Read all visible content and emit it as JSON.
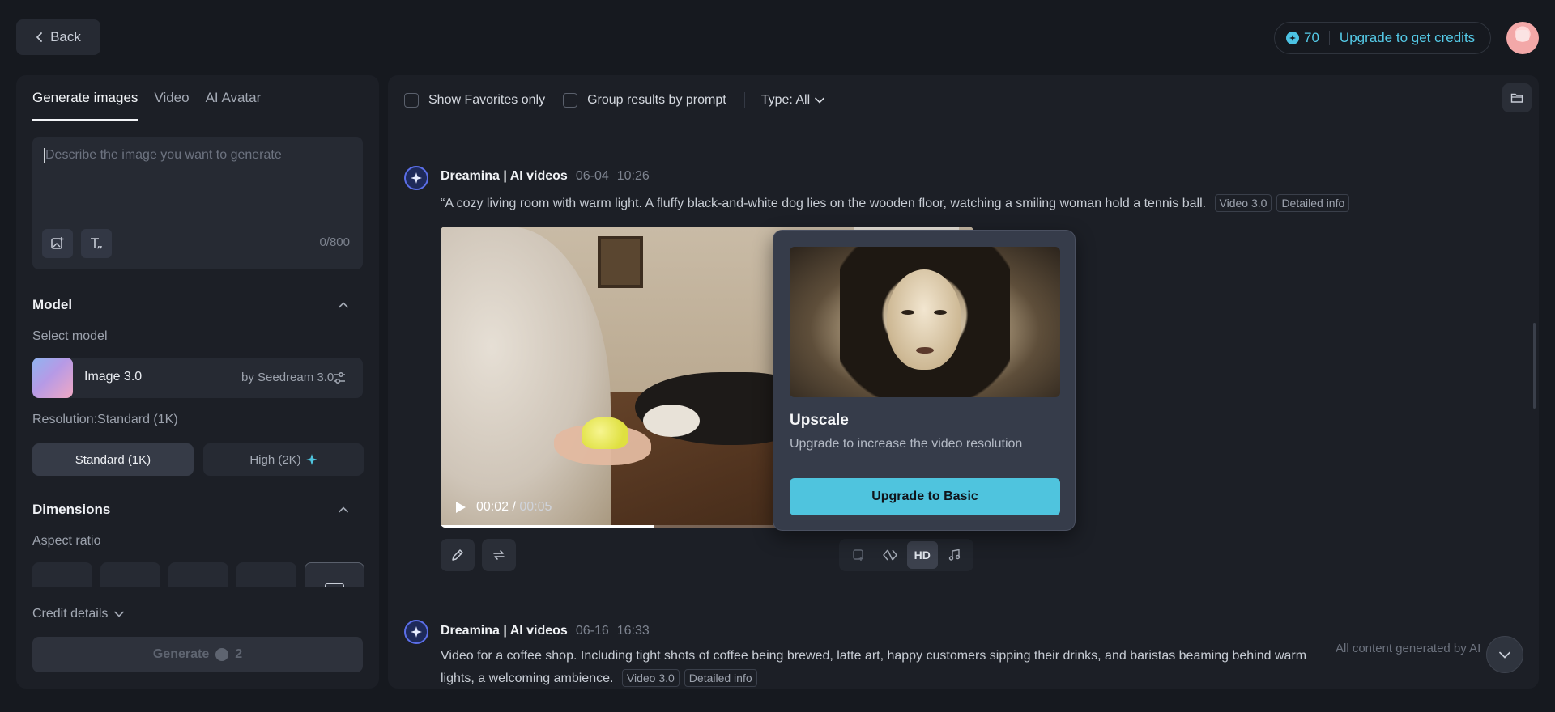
{
  "header": {
    "back_label": "Back",
    "credits_count": "70",
    "upgrade_label": "Upgrade to get credits"
  },
  "left": {
    "tabs": [
      {
        "label": "Generate images",
        "active": true
      },
      {
        "label": "Video",
        "active": false
      },
      {
        "label": "AI Avatar",
        "active": false
      }
    ],
    "prompt": {
      "placeholder": "Describe the image you want to generate",
      "value": "",
      "char_count": "0/800"
    },
    "model": {
      "section_title": "Model",
      "select_label": "Select model",
      "name": "Image 3.0",
      "by": "by Seedream 3.0"
    },
    "resolution": {
      "label": "Resolution:Standard (1K)",
      "options": [
        "Standard (1K)",
        "High (2K)"
      ],
      "selected": "Standard (1K)"
    },
    "dimensions": {
      "section_title": "Dimensions",
      "aspect_label": "Aspect ratio"
    },
    "credit_details_label": "Credit details",
    "generate_label": "Generate",
    "generate_cost": "2"
  },
  "filters": {
    "favorites_label": "Show Favorites only",
    "group_label": "Group results by prompt",
    "type_label": "Type: All"
  },
  "feed": [
    {
      "author": "Dreamina | AI videos",
      "date": "06-04",
      "time": "10:26",
      "prompt": "“A cozy living room with warm light. A fluffy black-and-white dog lies on the wooden floor, watching a smiling woman hold a tennis ball.",
      "model_tag": "Video 3.0",
      "info_tag": "Detailed info",
      "video": {
        "current": "00:02",
        "separator": "/",
        "duration": "00:05",
        "progress": 0.4
      }
    },
    {
      "author": "Dreamina | AI videos",
      "date": "06-16",
      "time": "16:33",
      "prompt": "Video for a coffee shop. Including tight shots of coffee being brewed, latte art, happy customers sipping their  drinks, and baristas beaming behind warm lights, a welcoming ambience.",
      "model_tag": "Video 3.0",
      "info_tag": "Detailed info"
    }
  ],
  "tools": {
    "hd_label": "HD"
  },
  "popover": {
    "title": "Upscale",
    "description": "Upgrade to increase the video resolution",
    "cta": "Upgrade to Basic"
  },
  "disclaimer": "All content generated by AI",
  "colors": {
    "accent": "#4fc4de",
    "background": "#16191f",
    "panel": "#1c1f26"
  }
}
